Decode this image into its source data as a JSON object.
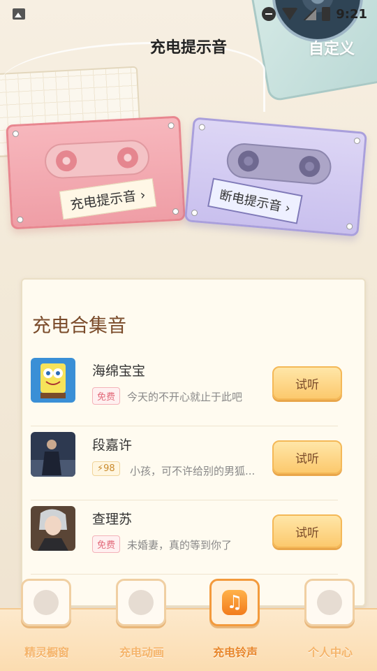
{
  "status_bar": {
    "time": "9:21"
  },
  "header": {
    "title": "充电提示音",
    "custom_label": "自定义"
  },
  "cassettes": {
    "charge": {
      "label": "充电提示音 ›"
    },
    "disconnect": {
      "label": "断电提示音 ›"
    }
  },
  "collection": {
    "title": "充电合集音",
    "items": [
      {
        "name": "海绵宝宝",
        "tag": "免费",
        "tag_type": "free",
        "desc": "今天的不开心就止于此吧",
        "button": "试听"
      },
      {
        "name": "段嘉许",
        "tag": "⚡98",
        "tag_type": "coin",
        "desc": "小孩，可不许给别的男狐...",
        "button": "试听"
      },
      {
        "name": "查理苏",
        "tag": "免费",
        "tag_type": "free",
        "desc": "未婚妻，真的等到你了",
        "button": "试听"
      }
    ]
  },
  "bottom_nav": [
    {
      "label": "精灵橱窗",
      "icon": "cat-icon",
      "active": false
    },
    {
      "label": "充电动画",
      "icon": "tv-icon",
      "active": false
    },
    {
      "label": "充电铃声",
      "icon": "music-note-icon",
      "active": true
    },
    {
      "label": "个人中心",
      "icon": "person-icon",
      "active": false
    }
  ],
  "colors": {
    "accent": "#f27c1c",
    "title_brown": "#7a4b2a",
    "pink_cassette": "#ef9ea6",
    "purple_cassette": "#c9c0ee"
  }
}
